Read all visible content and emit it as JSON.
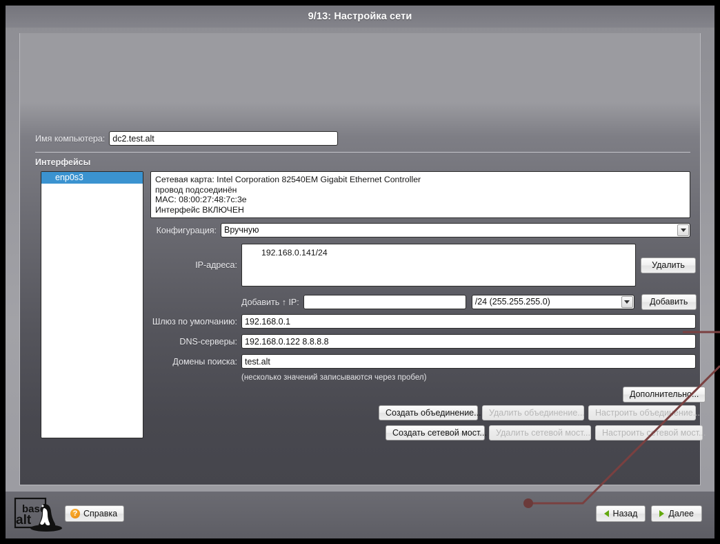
{
  "window": {
    "title": "9/13: Настройка сети"
  },
  "hostname": {
    "label": "Имя компьютера:",
    "value": "dc2.test.alt"
  },
  "interfaces": {
    "section_title": "Интерфейсы",
    "items": [
      {
        "name": "enp0s3",
        "selected": true
      }
    ],
    "info_lines": [
      "Сетевая карта: Intel Corporation 82540EM Gigabit Ethernet Controller",
      "провод подсоединён",
      "MAC: 08:00:27:48:7c:3e",
      "Интерфейс ВКЛЮЧЕН"
    ]
  },
  "config": {
    "label": "Конфигурация:",
    "value": "Вручную"
  },
  "ip": {
    "label": "IP-адреса:",
    "addresses": [
      "192.168.0.141/24"
    ],
    "delete_button": "Удалить",
    "add_label": "Добавить ↑ IP:",
    "add_value": "",
    "add_placeholder": "",
    "mask_value": "/24 (255.255.255.0)",
    "add_button": "Добавить"
  },
  "gateway": {
    "label": "Шлюз по умолчанию:",
    "value": "192.168.0.1"
  },
  "dns": {
    "label": "DNS-серверы:",
    "value": "192.168.0.122 8.8.8.8"
  },
  "domains": {
    "label": "Домены поиска:",
    "value": "test.alt",
    "hint": "(несколько значений записываются через пробел)"
  },
  "actions": {
    "advanced": "Дополнительно...",
    "create_bond": "Создать объединение...",
    "delete_bond": "Удалить объединение...",
    "config_bond": "Настроить объединение...",
    "create_bridge": "Создать сетевой мост...",
    "delete_bridge": "Удалить сетевой мост...",
    "config_bridge": "Настроить сетевой мост..."
  },
  "footer": {
    "logo_line1": "base",
    "logo_line2": "alt",
    "help": "Справка",
    "help_icon": "question-mark-icon",
    "back": "Назад",
    "next": "Далее",
    "back_icon": "triangle-left-icon",
    "next_icon": "triangle-right-icon"
  },
  "colors": {
    "accent_selection": "#3b93d0",
    "arrow_green": "#63a80e",
    "help_orange": "#e8870d",
    "deco_red": "#7a4040",
    "title_bar": "#7b7b82"
  }
}
